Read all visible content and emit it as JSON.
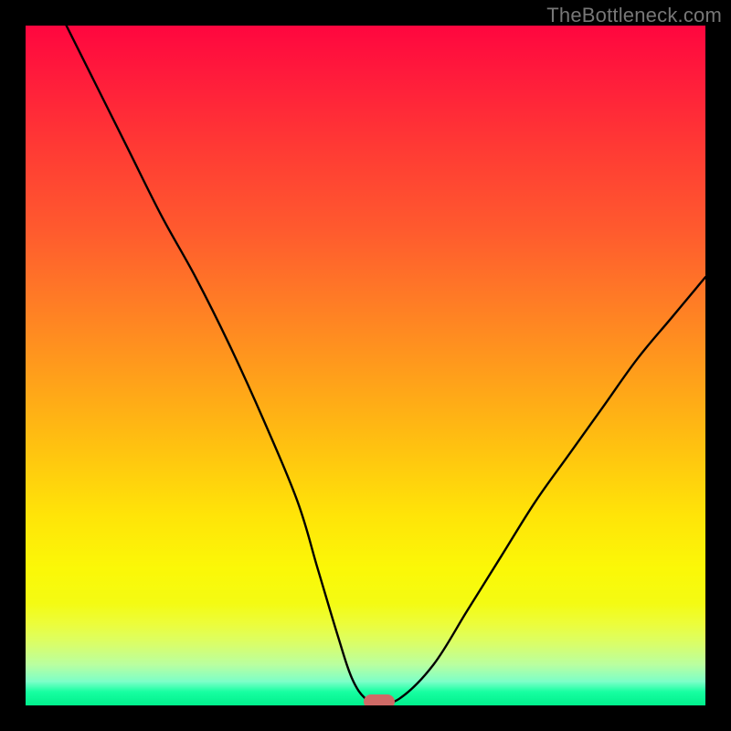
{
  "watermark": "TheBottleneck.com",
  "chart_data": {
    "type": "line",
    "title": "",
    "xlabel": "",
    "ylabel": "",
    "xlim": [
      0,
      100
    ],
    "ylim": [
      0,
      100
    ],
    "grid": false,
    "legend": false,
    "background": "red-yellow-green vertical gradient (high=red top, low=green bottom)",
    "series": [
      {
        "name": "bottleneck-curve",
        "x": [
          6,
          10,
          15,
          20,
          25,
          30,
          35,
          40,
          43,
          46,
          48,
          50,
          52,
          55,
          60,
          65,
          70,
          75,
          80,
          85,
          90,
          95,
          100
        ],
        "values": [
          100,
          92,
          82,
          72,
          63,
          53,
          42,
          30,
          20,
          10,
          4,
          1,
          0.5,
          1,
          6,
          14,
          22,
          30,
          37,
          44,
          51,
          57,
          63
        ]
      }
    ],
    "marker": {
      "x": 52,
      "y": 0.5,
      "color": "#cf6a66",
      "shape": "pill"
    }
  }
}
